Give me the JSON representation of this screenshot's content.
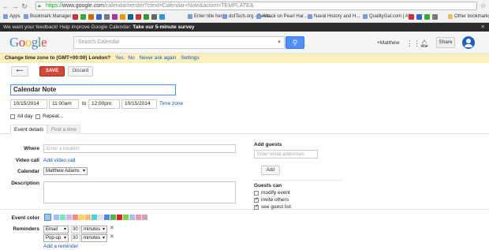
{
  "browser": {
    "url_scheme": "https://",
    "url_host": "www.google.com",
    "url_path": "/calendar/render?ctext=Calendar+Note&action=TEMPLATE&",
    "bookmarks": [
      "Apps",
      "Bookmark Manager",
      "Enter title here",
      "dotTech.org - Revie...",
      "Attack on Pearl Har...",
      "Naval History and H...",
      "QualityGal.com | All ..."
    ],
    "other_bookmarks": "Other bookmarks"
  },
  "feedback_bar": {
    "text": "We want your feedback! Help improve Google Calendar:",
    "link": "Take our 5-minute survey",
    "close": "✕"
  },
  "header": {
    "logo": "Google",
    "search_placeholder": "Search Calendar",
    "user": "+Matthew",
    "share": "Share"
  },
  "timezone_bar": {
    "text": "Change time zone to (GMT+00:00) London?",
    "yes": "Yes",
    "no": "No",
    "never": "Never ask again",
    "settings": "Settings"
  },
  "toolbar": {
    "back": "⟵",
    "save": "SAVE",
    "discard": "Discard"
  },
  "event": {
    "title": "Calendar Note",
    "start_date": "10/15/2014",
    "start_time": "11:00am",
    "to": "to",
    "end_time": "12:00pm",
    "end_date": "10/15/2014",
    "time_zone": "Time zone",
    "all_day": "All day",
    "repeat": "Repeat..."
  },
  "tabs": [
    "Event details",
    "Find a time"
  ],
  "details": {
    "where_label": "Where",
    "where_placeholder": "Enter a location",
    "video_label": "Video call",
    "video_link": "Add video call",
    "calendar_label": "Calendar",
    "calendar_value": "Matthew Adams",
    "description_label": "Description",
    "color_label": "Event color",
    "colors": [
      "#a4bdfc",
      "#7ae7bf",
      "#dbadff",
      "#ff887c",
      "#fbd75b",
      "#ffb878",
      "#46d6db",
      "#e1e1e1",
      "#5484ed",
      "#51b749",
      "#dc2127",
      "#7bd148",
      "#9fc6e7",
      "#f691b2",
      "#cca6ac"
    ],
    "reminders_label": "Reminders",
    "reminders": [
      {
        "type": "Email",
        "amount": "30",
        "unit": "minutes"
      },
      {
        "type": "Pop-up",
        "amount": "30",
        "unit": "minutes"
      }
    ],
    "add_reminder": "Add a reminder"
  },
  "guests": {
    "heading": "Add guests",
    "placeholder": "Enter email addresses",
    "add_button": "Add",
    "can_heading": "Guests can",
    "options": [
      {
        "label": "modify event",
        "checked": false
      },
      {
        "label": "invite others",
        "checked": true
      },
      {
        "label": "see guest list",
        "checked": true
      }
    ]
  }
}
